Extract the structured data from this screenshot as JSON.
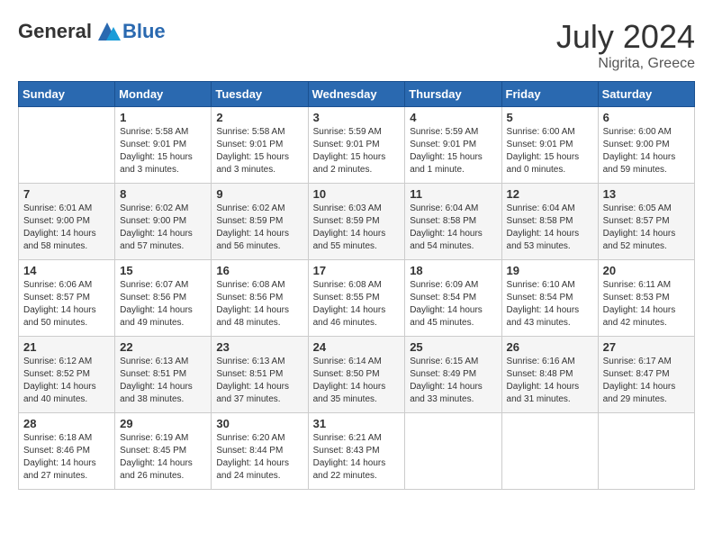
{
  "header": {
    "logo_general": "General",
    "logo_blue": "Blue",
    "month_year": "July 2024",
    "location": "Nigrita, Greece"
  },
  "days_of_week": [
    "Sunday",
    "Monday",
    "Tuesday",
    "Wednesday",
    "Thursday",
    "Friday",
    "Saturday"
  ],
  "weeks": [
    [
      {
        "day": "",
        "sunrise": "",
        "sunset": "",
        "daylight": ""
      },
      {
        "day": "1",
        "sunrise": "Sunrise: 5:58 AM",
        "sunset": "Sunset: 9:01 PM",
        "daylight": "Daylight: 15 hours and 3 minutes."
      },
      {
        "day": "2",
        "sunrise": "Sunrise: 5:58 AM",
        "sunset": "Sunset: 9:01 PM",
        "daylight": "Daylight: 15 hours and 3 minutes."
      },
      {
        "day": "3",
        "sunrise": "Sunrise: 5:59 AM",
        "sunset": "Sunset: 9:01 PM",
        "daylight": "Daylight: 15 hours and 2 minutes."
      },
      {
        "day": "4",
        "sunrise": "Sunrise: 5:59 AM",
        "sunset": "Sunset: 9:01 PM",
        "daylight": "Daylight: 15 hours and 1 minute."
      },
      {
        "day": "5",
        "sunrise": "Sunrise: 6:00 AM",
        "sunset": "Sunset: 9:01 PM",
        "daylight": "Daylight: 15 hours and 0 minutes."
      },
      {
        "day": "6",
        "sunrise": "Sunrise: 6:00 AM",
        "sunset": "Sunset: 9:00 PM",
        "daylight": "Daylight: 14 hours and 59 minutes."
      }
    ],
    [
      {
        "day": "7",
        "sunrise": "Sunrise: 6:01 AM",
        "sunset": "Sunset: 9:00 PM",
        "daylight": "Daylight: 14 hours and 58 minutes."
      },
      {
        "day": "8",
        "sunrise": "Sunrise: 6:02 AM",
        "sunset": "Sunset: 9:00 PM",
        "daylight": "Daylight: 14 hours and 57 minutes."
      },
      {
        "day": "9",
        "sunrise": "Sunrise: 6:02 AM",
        "sunset": "Sunset: 8:59 PM",
        "daylight": "Daylight: 14 hours and 56 minutes."
      },
      {
        "day": "10",
        "sunrise": "Sunrise: 6:03 AM",
        "sunset": "Sunset: 8:59 PM",
        "daylight": "Daylight: 14 hours and 55 minutes."
      },
      {
        "day": "11",
        "sunrise": "Sunrise: 6:04 AM",
        "sunset": "Sunset: 8:58 PM",
        "daylight": "Daylight: 14 hours and 54 minutes."
      },
      {
        "day": "12",
        "sunrise": "Sunrise: 6:04 AM",
        "sunset": "Sunset: 8:58 PM",
        "daylight": "Daylight: 14 hours and 53 minutes."
      },
      {
        "day": "13",
        "sunrise": "Sunrise: 6:05 AM",
        "sunset": "Sunset: 8:57 PM",
        "daylight": "Daylight: 14 hours and 52 minutes."
      }
    ],
    [
      {
        "day": "14",
        "sunrise": "Sunrise: 6:06 AM",
        "sunset": "Sunset: 8:57 PM",
        "daylight": "Daylight: 14 hours and 50 minutes."
      },
      {
        "day": "15",
        "sunrise": "Sunrise: 6:07 AM",
        "sunset": "Sunset: 8:56 PM",
        "daylight": "Daylight: 14 hours and 49 minutes."
      },
      {
        "day": "16",
        "sunrise": "Sunrise: 6:08 AM",
        "sunset": "Sunset: 8:56 PM",
        "daylight": "Daylight: 14 hours and 48 minutes."
      },
      {
        "day": "17",
        "sunrise": "Sunrise: 6:08 AM",
        "sunset": "Sunset: 8:55 PM",
        "daylight": "Daylight: 14 hours and 46 minutes."
      },
      {
        "day": "18",
        "sunrise": "Sunrise: 6:09 AM",
        "sunset": "Sunset: 8:54 PM",
        "daylight": "Daylight: 14 hours and 45 minutes."
      },
      {
        "day": "19",
        "sunrise": "Sunrise: 6:10 AM",
        "sunset": "Sunset: 8:54 PM",
        "daylight": "Daylight: 14 hours and 43 minutes."
      },
      {
        "day": "20",
        "sunrise": "Sunrise: 6:11 AM",
        "sunset": "Sunset: 8:53 PM",
        "daylight": "Daylight: 14 hours and 42 minutes."
      }
    ],
    [
      {
        "day": "21",
        "sunrise": "Sunrise: 6:12 AM",
        "sunset": "Sunset: 8:52 PM",
        "daylight": "Daylight: 14 hours and 40 minutes."
      },
      {
        "day": "22",
        "sunrise": "Sunrise: 6:13 AM",
        "sunset": "Sunset: 8:51 PM",
        "daylight": "Daylight: 14 hours and 38 minutes."
      },
      {
        "day": "23",
        "sunrise": "Sunrise: 6:13 AM",
        "sunset": "Sunset: 8:51 PM",
        "daylight": "Daylight: 14 hours and 37 minutes."
      },
      {
        "day": "24",
        "sunrise": "Sunrise: 6:14 AM",
        "sunset": "Sunset: 8:50 PM",
        "daylight": "Daylight: 14 hours and 35 minutes."
      },
      {
        "day": "25",
        "sunrise": "Sunrise: 6:15 AM",
        "sunset": "Sunset: 8:49 PM",
        "daylight": "Daylight: 14 hours and 33 minutes."
      },
      {
        "day": "26",
        "sunrise": "Sunrise: 6:16 AM",
        "sunset": "Sunset: 8:48 PM",
        "daylight": "Daylight: 14 hours and 31 minutes."
      },
      {
        "day": "27",
        "sunrise": "Sunrise: 6:17 AM",
        "sunset": "Sunset: 8:47 PM",
        "daylight": "Daylight: 14 hours and 29 minutes."
      }
    ],
    [
      {
        "day": "28",
        "sunrise": "Sunrise: 6:18 AM",
        "sunset": "Sunset: 8:46 PM",
        "daylight": "Daylight: 14 hours and 27 minutes."
      },
      {
        "day": "29",
        "sunrise": "Sunrise: 6:19 AM",
        "sunset": "Sunset: 8:45 PM",
        "daylight": "Daylight: 14 hours and 26 minutes."
      },
      {
        "day": "30",
        "sunrise": "Sunrise: 6:20 AM",
        "sunset": "Sunset: 8:44 PM",
        "daylight": "Daylight: 14 hours and 24 minutes."
      },
      {
        "day": "31",
        "sunrise": "Sunrise: 6:21 AM",
        "sunset": "Sunset: 8:43 PM",
        "daylight": "Daylight: 14 hours and 22 minutes."
      },
      {
        "day": "",
        "sunrise": "",
        "sunset": "",
        "daylight": ""
      },
      {
        "day": "",
        "sunrise": "",
        "sunset": "",
        "daylight": ""
      },
      {
        "day": "",
        "sunrise": "",
        "sunset": "",
        "daylight": ""
      }
    ]
  ]
}
